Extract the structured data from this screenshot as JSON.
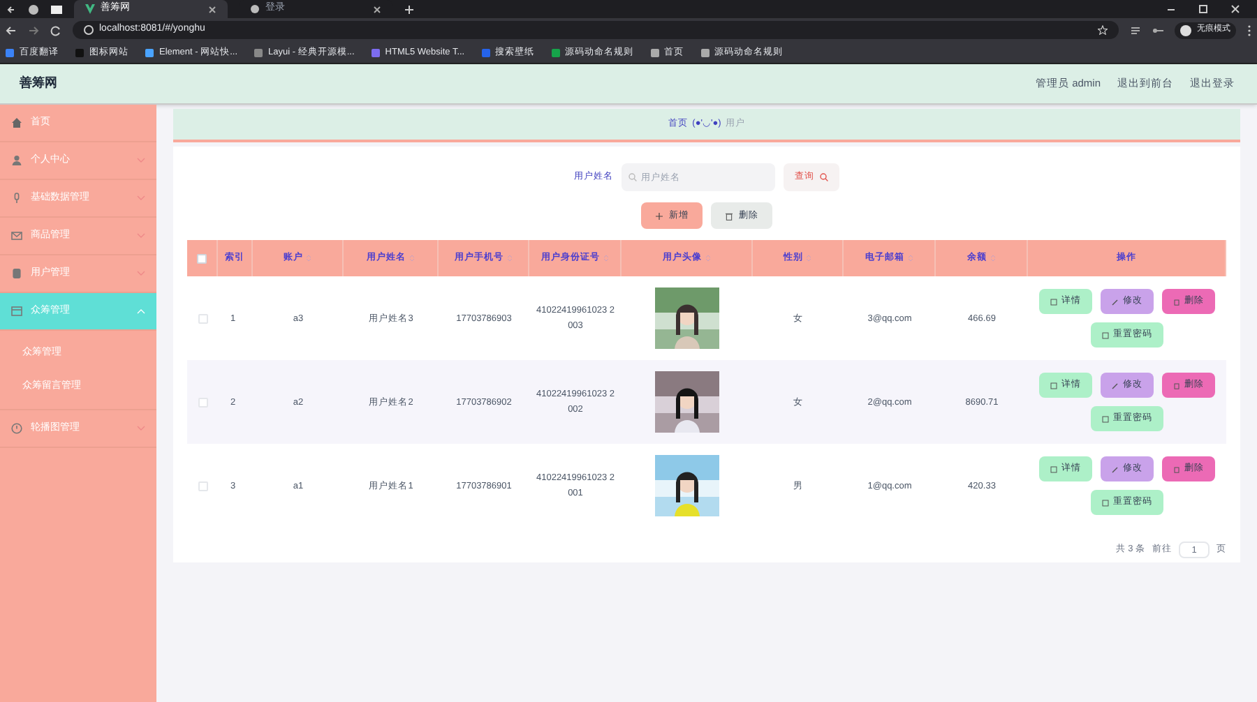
{
  "browser": {
    "tabs": [
      {
        "title": "善筹网",
        "selected": true
      },
      {
        "title": "登录",
        "selected": false
      }
    ],
    "url": "localhost:8081/#/yonghu",
    "profile": "无痕模式",
    "bookmarks": [
      "百度翻译",
      "图标网站",
      "Element - 网站快...",
      "Layui - 经典开源模...",
      "HTML5 Website T...",
      "搜索壁纸",
      "源码动命名规则",
      "首页",
      "源码动命名规则"
    ]
  },
  "header": {
    "title": "善筹网",
    "user": "管理员 admin",
    "links": [
      "退出到前台",
      "退出登录"
    ]
  },
  "sidebar": {
    "items": [
      {
        "label": "首页",
        "selected": false,
        "has_children": false
      },
      {
        "label": "个人中心",
        "expanded": false,
        "selected": false,
        "has_children": true
      },
      {
        "label": "基础数据管理",
        "expanded": false,
        "selected": false,
        "has_children": true
      },
      {
        "label": "商品管理",
        "expanded": false,
        "selected": false,
        "has_children": true
      },
      {
        "label": "用户管理",
        "expanded": false,
        "selected": false,
        "has_children": true
      },
      {
        "label": "众筹管理",
        "expanded": true,
        "selected": true,
        "has_children": true,
        "children": [
          {
            "label": "众筹管理"
          },
          {
            "label": "众筹留言管理"
          }
        ]
      },
      {
        "label": "轮播图管理",
        "expanded": false,
        "selected": false,
        "has_children": true
      }
    ]
  },
  "breadcrumb": {
    "home": "首页",
    "separator": "(●'◡'●)",
    "current": "用户"
  },
  "search": {
    "label": "用户姓名",
    "placeholder": "用户姓名",
    "button": "查询"
  },
  "actions": [
    "新增",
    "删除"
  ],
  "table": {
    "select_all": {
      "checked": false
    },
    "columns": [
      {
        "label": "索引",
        "sortable": false
      },
      {
        "label": "账户",
        "sortable": true
      },
      {
        "label": "用户姓名",
        "sortable": true
      },
      {
        "label": "用户手机号",
        "sortable": true
      },
      {
        "label": "用户身份证号",
        "sortable": true
      },
      {
        "label": "用户头像",
        "sortable": true
      },
      {
        "label": "性别",
        "sortable": true
      },
      {
        "label": "电子邮箱",
        "sortable": true
      },
      {
        "label": "余额",
        "sortable": true
      },
      {
        "label": "操作",
        "sortable": false
      }
    ],
    "rows": [
      {
        "checked": false,
        "index": "1",
        "account": "a3",
        "name": "用户姓名3",
        "phone": "17703786903",
        "id_card": "41022419961023 2003",
        "gender": "女",
        "email": "3@qq.com",
        "balance": "466.69",
        "buttons": [
          {
            "label": "详情",
            "kind": "detail"
          },
          {
            "label": "修改",
            "kind": "edit"
          },
          {
            "label": "删除",
            "kind": "delete"
          },
          {
            "label": "重置密码",
            "kind": "reset"
          }
        ]
      },
      {
        "checked": false,
        "index": "2",
        "account": "a2",
        "name": "用户姓名2",
        "phone": "17703786902",
        "id_card": "41022419961023 2002",
        "gender": "女",
        "email": "2@qq.com",
        "balance": "8690.71",
        "buttons": [
          {
            "label": "详情",
            "kind": "detail"
          },
          {
            "label": "修改",
            "kind": "edit"
          },
          {
            "label": "删除",
            "kind": "delete"
          },
          {
            "label": "重置密码",
            "kind": "reset"
          }
        ]
      },
      {
        "checked": false,
        "index": "3",
        "account": "a1",
        "name": "用户姓名1",
        "phone": "17703786901",
        "id_card": "41022419961023 2001",
        "gender": "男",
        "email": "1@qq.com",
        "balance": "420.33",
        "buttons": [
          {
            "label": "详情",
            "kind": "detail"
          },
          {
            "label": "修改",
            "kind": "edit"
          },
          {
            "label": "删除",
            "kind": "delete"
          },
          {
            "label": "重置密码",
            "kind": "reset"
          }
        ]
      }
    ]
  },
  "pagination": {
    "total": "共 3 条",
    "goto": "前往",
    "page": "1",
    "unit": "页"
  }
}
